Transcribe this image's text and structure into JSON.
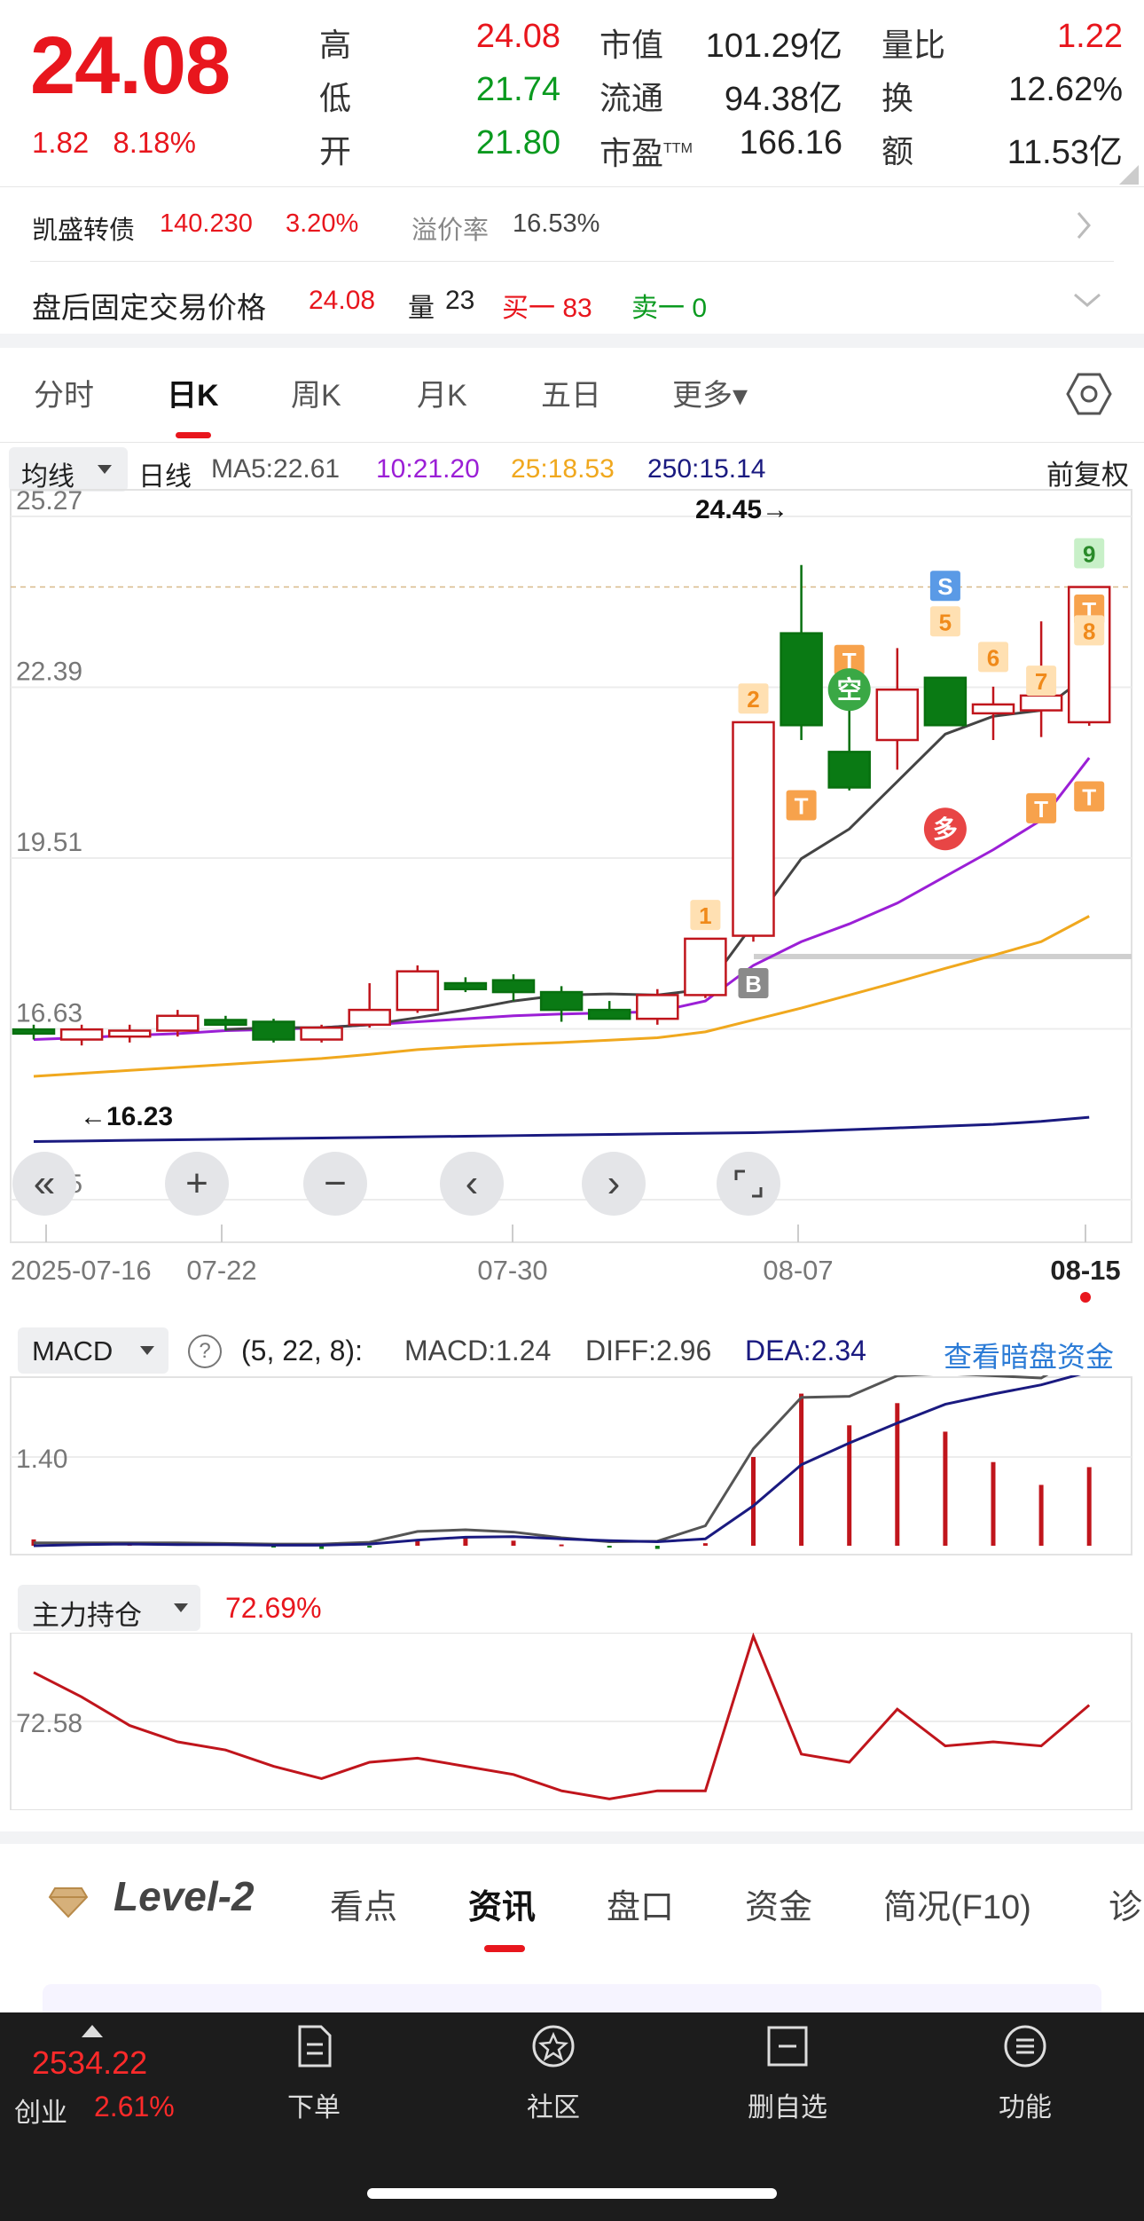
{
  "quote": {
    "price": "24.08",
    "change_abs": "1.82",
    "change_pct": "8.18%",
    "stats": [
      {
        "label": "高",
        "value": "24.08",
        "color": "#e8161d"
      },
      {
        "label": "低",
        "value": "21.74",
        "color": "#0a9a1f"
      },
      {
        "label": "开",
        "value": "21.80",
        "color": "#0a9a1f"
      },
      {
        "label": "市值",
        "value": "101.29亿",
        "color": "#222222"
      },
      {
        "label": "流通",
        "value": "94.38亿",
        "color": "#222222"
      },
      {
        "label": "市盈",
        "sup": "TTM",
        "value": "166.16",
        "color": "#222222"
      },
      {
        "label": "量比",
        "value": "1.22",
        "color": "#e8161d"
      },
      {
        "label": "换",
        "value": "12.62%",
        "color": "#222222"
      },
      {
        "label": "额",
        "value": "11.53亿",
        "color": "#222222"
      }
    ]
  },
  "bond": {
    "name": "凯盛转债",
    "price": "140.230",
    "pct": "3.20%",
    "premium_label": "溢价率",
    "premium": "16.53%"
  },
  "after_hours": {
    "label": "盘后固定交易价格",
    "price": "24.08",
    "vol_label": "量",
    "vol": "23",
    "buy": "买一 83",
    "sell": "卖一 0"
  },
  "tabs": [
    {
      "label": "分时",
      "active": false
    },
    {
      "label": "日K",
      "active": true
    },
    {
      "label": "周K",
      "active": false
    },
    {
      "label": "月K",
      "active": false
    },
    {
      "label": "五日",
      "active": false
    },
    {
      "label": "更多▾",
      "active": false
    }
  ],
  "ma_bar": {
    "selector": "均线",
    "period": "日线",
    "ma5": "MA5:22.61",
    "ma10": "10:21.20",
    "ma25": "25:18.53",
    "ma250": "250:15.14",
    "adjust": "前复权",
    "colors": {
      "ma5": "#444444",
      "ma10": "#9b1fd6",
      "ma25": "#f0a81e",
      "ma250": "#1a1a80"
    }
  },
  "chart_data": {
    "type": "candlestick",
    "y_ticks": [
      "25.27",
      "22.39",
      "19.51",
      "16.63",
      "13.75"
    ],
    "ylim": [
      13.75,
      25.27
    ],
    "x_labels": [
      "2025-07-16",
      "07-22",
      "07-30",
      "08-07",
      "08-15"
    ],
    "annotations": {
      "high": "24.45→",
      "low": "←16.23"
    },
    "candles": [
      {
        "o": 16.62,
        "h": 16.7,
        "l": 16.45,
        "c": 16.55
      },
      {
        "o": 16.45,
        "h": 16.7,
        "l": 16.35,
        "c": 16.62
      },
      {
        "o": 16.5,
        "h": 16.7,
        "l": 16.4,
        "c": 16.6
      },
      {
        "o": 16.6,
        "h": 16.95,
        "l": 16.5,
        "c": 16.85
      },
      {
        "o": 16.78,
        "h": 16.85,
        "l": 16.6,
        "c": 16.7
      },
      {
        "o": 16.75,
        "h": 16.8,
        "l": 16.4,
        "c": 16.45
      },
      {
        "o": 16.45,
        "h": 16.7,
        "l": 16.4,
        "c": 16.65
      },
      {
        "o": 16.7,
        "h": 17.4,
        "l": 16.65,
        "c": 16.95
      },
      {
        "o": 16.95,
        "h": 17.7,
        "l": 16.9,
        "c": 17.6
      },
      {
        "o": 17.4,
        "h": 17.5,
        "l": 17.25,
        "c": 17.3
      },
      {
        "o": 17.45,
        "h": 17.55,
        "l": 17.1,
        "c": 17.25
      },
      {
        "o": 17.25,
        "h": 17.35,
        "l": 16.75,
        "c": 16.95
      },
      {
        "o": 16.95,
        "h": 17.1,
        "l": 16.85,
        "c": 16.8
      },
      {
        "o": 16.8,
        "h": 17.3,
        "l": 16.7,
        "c": 17.2
      },
      {
        "o": 17.2,
        "h": 18.15,
        "l": 17.15,
        "c": 18.15
      },
      {
        "o": 18.2,
        "h": 21.8,
        "l": 18.1,
        "c": 21.8
      },
      {
        "o": 23.3,
        "h": 24.45,
        "l": 21.5,
        "c": 21.75
      },
      {
        "o": 21.3,
        "h": 22.0,
        "l": 20.65,
        "c": 20.7
      },
      {
        "o": 21.5,
        "h": 23.05,
        "l": 21.0,
        "c": 22.35
      },
      {
        "o": 22.55,
        "h": 22.55,
        "l": 21.75,
        "c": 21.75
      },
      {
        "o": 21.95,
        "h": 22.4,
        "l": 21.5,
        "c": 22.1
      },
      {
        "o": 22.0,
        "h": 23.5,
        "l": 21.55,
        "c": 22.25
      },
      {
        "o": 21.8,
        "h": 24.08,
        "l": 21.74,
        "c": 24.08
      }
    ],
    "ma5": [
      null,
      null,
      null,
      null,
      16.62,
      16.65,
      16.65,
      16.7,
      16.82,
      16.95,
      17.1,
      17.2,
      17.22,
      17.2,
      17.3,
      18.4,
      19.5,
      20.0,
      20.8,
      21.6,
      21.9,
      22.0,
      22.61
    ],
    "ma10": [
      16.45,
      16.48,
      16.52,
      16.55,
      16.6,
      16.62,
      16.65,
      16.7,
      16.75,
      16.8,
      16.85,
      16.88,
      16.9,
      16.92,
      17.1,
      17.7,
      18.1,
      18.4,
      18.75,
      19.2,
      19.65,
      20.15,
      21.2
    ],
    "ma25": [
      15.83,
      15.88,
      15.93,
      15.98,
      16.03,
      16.08,
      16.13,
      16.2,
      16.28,
      16.33,
      16.37,
      16.4,
      16.44,
      16.48,
      16.58,
      16.78,
      16.98,
      17.2,
      17.42,
      17.65,
      17.87,
      18.1,
      18.53
    ],
    "ma250": [
      14.73,
      14.74,
      14.75,
      14.76,
      14.77,
      14.78,
      14.79,
      14.8,
      14.81,
      14.82,
      14.83,
      14.84,
      14.85,
      14.86,
      14.87,
      14.88,
      14.9,
      14.93,
      14.96,
      14.99,
      15.02,
      15.07,
      15.14
    ],
    "signals": {
      "labels": [
        "1",
        "2",
        "T",
        "T",
        "空",
        "S",
        "5",
        "多",
        "6",
        "7",
        "T",
        "8",
        "T",
        "T",
        "9",
        "B"
      ]
    }
  },
  "macd": {
    "selector": "MACD",
    "help": "?",
    "params": "(5, 22, 8):",
    "macd_value": "MACD:1.24",
    "diff_value": "DIFF:2.96",
    "dea_value": "DEA:2.34",
    "link": "查看暗盘资金",
    "tick": "1.40",
    "hist": [
      0.1,
      0.06,
      0.03,
      0.05,
      0.03,
      -0.02,
      -0.05,
      -0.03,
      0.1,
      0.12,
      0.08,
      0.02,
      -0.03,
      -0.05,
      0.04,
      1.4,
      2.4,
      1.9,
      2.25,
      1.8,
      1.32,
      0.96,
      1.24
    ],
    "diff": [
      0.05,
      0.05,
      0.05,
      0.05,
      0.04,
      0.03,
      0.03,
      0.06,
      0.25,
      0.28,
      0.24,
      0.14,
      0.07,
      0.08,
      0.35,
      1.7,
      2.6,
      2.62,
      2.98,
      3.02,
      2.98,
      2.94,
      3.42
    ],
    "dea": [
      0.0,
      0.02,
      0.03,
      0.02,
      0.02,
      0.01,
      0.01,
      0.03,
      0.1,
      0.15,
      0.16,
      0.12,
      0.09,
      0.07,
      0.12,
      0.7,
      1.42,
      1.8,
      2.15,
      2.48,
      2.66,
      2.82,
      3.05
    ]
  },
  "holdings": {
    "selector": "主力持仓",
    "value": "72.69%",
    "tick": "72.58",
    "series": [
      72.7,
      72.64,
      72.57,
      72.53,
      72.51,
      72.47,
      72.44,
      72.48,
      72.49,
      72.47,
      72.45,
      72.41,
      72.39,
      72.41,
      72.41,
      72.81,
      72.5,
      72.48,
      72.61,
      72.52,
      72.53,
      72.52,
      72.62
    ]
  },
  "controls": {
    "icons": [
      "double-left-icon",
      "zoom-in-icon",
      "zoom-out-icon",
      "prev-icon",
      "next-icon",
      "fullscreen-icon"
    ]
  },
  "bottom_tabs": {
    "level2": "Level-2",
    "items": [
      "看点",
      "资讯",
      "盘口",
      "资金",
      "简况(F10)",
      "诊"
    ],
    "active": "资讯"
  },
  "bottom_nav": {
    "index_value": "2534.22",
    "index_name": "创业",
    "index_pct": "2.61%",
    "items": [
      {
        "label": "下单",
        "icon": "order-icon"
      },
      {
        "label": "社区",
        "icon": "community-icon"
      },
      {
        "label": "删自选",
        "icon": "remove-watchlist-icon"
      },
      {
        "label": "功能",
        "icon": "menu-icon"
      }
    ]
  }
}
